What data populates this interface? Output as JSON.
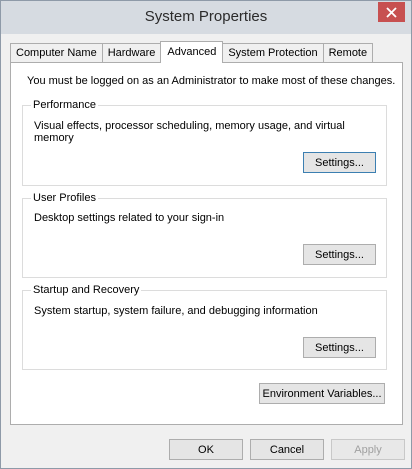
{
  "window": {
    "title": "System Properties"
  },
  "tabs": [
    {
      "label": "Computer Name"
    },
    {
      "label": "Hardware"
    },
    {
      "label": "Advanced"
    },
    {
      "label": "System Protection"
    },
    {
      "label": "Remote"
    }
  ],
  "active_tab": "Advanced",
  "admin_note": "You must be logged on as an Administrator to make most of these changes.",
  "groups": {
    "performance": {
      "title": "Performance",
      "description": "Visual effects, processor scheduling, memory usage, and virtual memory",
      "button": "Settings..."
    },
    "user_profiles": {
      "title": "User Profiles",
      "description": "Desktop settings related to your sign-in",
      "button": "Settings..."
    },
    "startup_recovery": {
      "title": "Startup and Recovery",
      "description": "System startup, system failure, and debugging information",
      "button": "Settings..."
    }
  },
  "env_button": "Environment Variables...",
  "footer": {
    "ok": "OK",
    "cancel": "Cancel",
    "apply": "Apply"
  },
  "icons": {
    "close": "close-icon"
  },
  "colors": {
    "titlebar": "#d6dbe1",
    "close_button": "#c75050",
    "default_button_border": "#3c7fb1"
  }
}
